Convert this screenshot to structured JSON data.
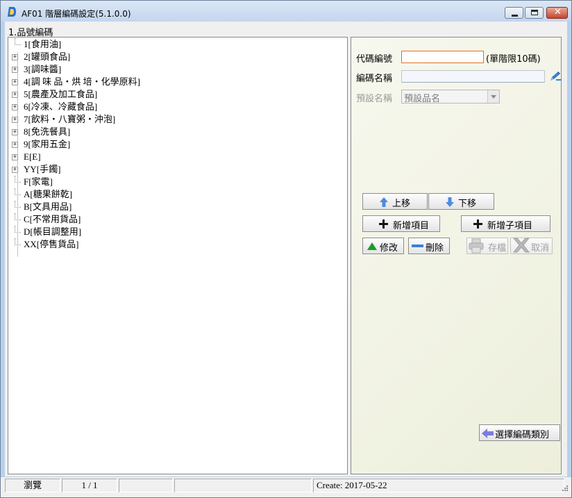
{
  "window": {
    "title": "AF01 階層編碼設定(5.1.0.0)",
    "close_glyph": "✕"
  },
  "group_label": "1.品號編碼",
  "tree": [
    {
      "label": "1[食用油]",
      "expandable": false
    },
    {
      "label": "2[罐頭食品]",
      "expandable": true
    },
    {
      "label": "3[調味醬]",
      "expandable": true
    },
    {
      "label": "4[調 味 品・烘 培・化學原料]",
      "expandable": true
    },
    {
      "label": "5[農產及加工食品]",
      "expandable": true
    },
    {
      "label": "6[冷凍、冷藏食品]",
      "expandable": true
    },
    {
      "label": "7[飲料・八寶粥・沖泡]",
      "expandable": true
    },
    {
      "label": "8[免洗餐具]",
      "expandable": true
    },
    {
      "label": "9[家用五金]",
      "expandable": true
    },
    {
      "label": "E[E]",
      "expandable": true
    },
    {
      "label": "YY[手鐲]",
      "expandable": true
    },
    {
      "label": "F[家電]",
      "expandable": false
    },
    {
      "label": "A[糖果餅乾]",
      "expandable": false
    },
    {
      "label": "B[文具用品]",
      "expandable": false
    },
    {
      "label": "C[不常用貨品]",
      "expandable": false
    },
    {
      "label": "D[帳目調整用]",
      "expandable": false
    },
    {
      "label": "XX[停售貨品]",
      "expandable": false
    }
  ],
  "expand_glyph": "+",
  "form": {
    "code_label": "代碼編號",
    "code_value": "",
    "code_hint": "(單階限10碼)",
    "name_label": "編碼名稱",
    "name_value": "",
    "default_label": "預設名稱",
    "default_value": "預設品名"
  },
  "buttons": {
    "move_up": "上移",
    "move_down": "下移",
    "add_item": "新增項目",
    "add_child": "新增子項目",
    "edit": "修改",
    "delete": "刪除",
    "save": "存檔",
    "cancel": "取消",
    "select_category": "選擇編碼類別"
  },
  "status": {
    "mode": "瀏覽",
    "page": "1 / 1",
    "cell3": "",
    "cell4": "",
    "created": "Create:  2017-05-22"
  },
  "colors": {
    "accent_blue": "#3c7fd8",
    "add_black": "#111111",
    "edit_green": "#1e9a2a",
    "disabled_gray": "#9a9a9a"
  }
}
